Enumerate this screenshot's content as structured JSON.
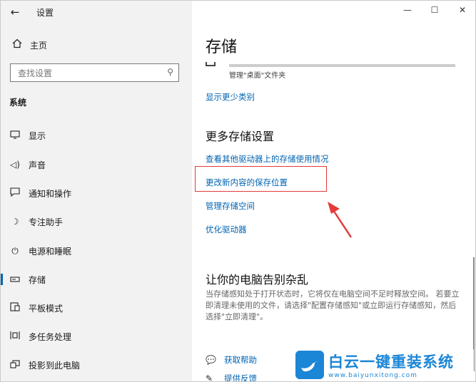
{
  "app": {
    "title": "设置",
    "back_icon": "back-arrow-icon"
  },
  "sidebar": {
    "home_label": "主页",
    "search_placeholder": "查找设置",
    "section_label": "系统",
    "items": [
      {
        "label": "显示",
        "icon": "display-icon"
      },
      {
        "label": "声音",
        "icon": "sound-icon"
      },
      {
        "label": "通知和操作",
        "icon": "notification-icon"
      },
      {
        "label": "专注助手",
        "icon": "moon-icon"
      },
      {
        "label": "电源和睡眠",
        "icon": "power-icon"
      },
      {
        "label": "存储",
        "icon": "storage-icon",
        "active": true
      },
      {
        "label": "平板模式",
        "icon": "tablet-icon"
      },
      {
        "label": "多任务处理",
        "icon": "multitask-icon"
      },
      {
        "label": "投影到此电脑",
        "icon": "project-icon"
      }
    ]
  },
  "window_controls": {
    "minimize": "—",
    "maximize": "☐",
    "close": "✕"
  },
  "main": {
    "title": "存储",
    "usage_caption": "管理\"桌面\"文件夹",
    "show_fewer_link": "显示更少类别",
    "more_storage_heading": "更多存储设置",
    "links": [
      "查看其他驱动器上的存储使用情况",
      "更改新内容的保存位置",
      "管理存储空间",
      "优化驱动器"
    ],
    "clutter_heading": "让你的电脑告别杂乱",
    "clutter_desc": "当存储感知处于打开状态时，它将仅在电脑空间不足时释放空间。 若要立即清理未使用的文件，请选择\"配置存储感知\"或立即运行存储感知，然后选择\"立即清理\"。",
    "help_links": [
      "获取帮助",
      "提供反馈"
    ]
  },
  "watermark": {
    "title": "白云一键重装系统",
    "url": "www.baiyunxitong.com"
  },
  "colors": {
    "accent": "#0063b1",
    "highlight": "#e33b3b",
    "brand": "#1c86d6"
  }
}
